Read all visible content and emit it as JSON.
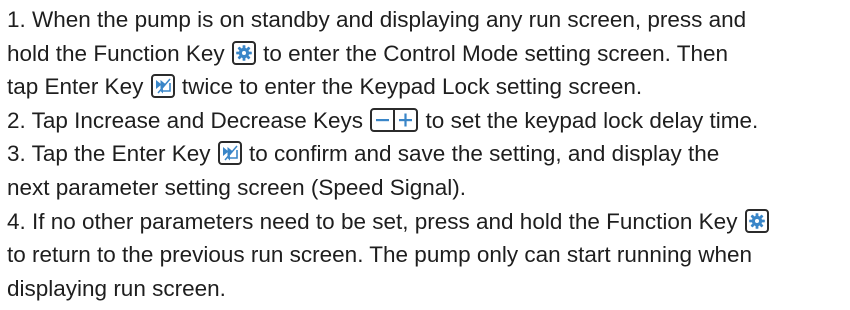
{
  "icons": {
    "function_key": "gear-icon",
    "enter_key": "fast-forward-enter-icon",
    "decrease_key": "minus-icon",
    "increase_key": "plus-icon",
    "accent": "#3a86c8",
    "border": "#2b2b2b"
  },
  "instructions": {
    "step1": {
      "line1": "1.  When the pump is on standby and displaying any run screen, press and",
      "line2_before": "hold the Function Key ",
      "line2_after": " to enter the Control Mode setting screen. Then",
      "line3_before": "tap Enter Key ",
      "line3_after": " twice to enter the Keypad Lock setting screen."
    },
    "step2": {
      "before": "2.  Tap Increase and Decrease Keys ",
      "after": " to set the keypad lock delay time."
    },
    "step3": {
      "line1_before": "3.  Tap the Enter Key  ",
      "line1_after": "  to confirm and save the setting, and display the",
      "line2": "next parameter setting screen (Speed Signal)."
    },
    "step4": {
      "line1_before": "4.  If no other parameters need to be set, press and hold the Function Key ",
      "line2": "to return to the previous run screen. The pump only can start running when",
      "line3": "displaying run screen."
    }
  }
}
